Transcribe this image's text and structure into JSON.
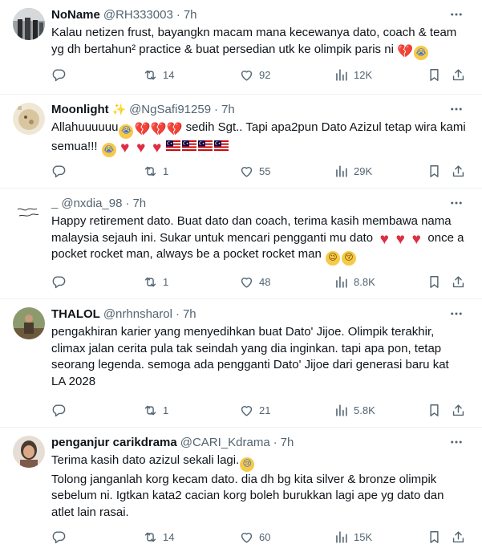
{
  "colors": {
    "text": "#0f1419",
    "muted": "#536471",
    "divider": "#eff3f4",
    "heart": "#dd2e44"
  },
  "tweets": [
    {
      "name": "NoName",
      "handle": "@RH333003",
      "time": "7h",
      "text1": "Kalau netizen frust, bayangkn macam mana kecewanya dato, coach & team yg dh bertahun² practice & buat persedian utk ke olimpik paris ni",
      "replies": "",
      "retweets": "14",
      "likes": "92",
      "views": "12K"
    },
    {
      "name": "Moonlight",
      "handle": "@NgSafi91259",
      "time": "7h",
      "text1": "Allahuuuuuu",
      "text2": "sedih Sgt.. Tapi apa2pun Dato Azizul tetap wira kami semua!!!",
      "replies": "",
      "retweets": "1",
      "likes": "55",
      "views": "29K"
    },
    {
      "name": "_",
      "handle": "@nxdia_98",
      "time": "7h",
      "text1": "Happy retirement dato. Buat dato dan coach, terima kasih membawa nama malaysia sejauh ini. Sukar untuk mencari pengganti mu dato",
      "text2": "once a pocket rocket man, always be a pocket rocket man",
      "replies": "",
      "retweets": "1",
      "likes": "48",
      "views": "8.8K"
    },
    {
      "name": "THALOL",
      "handle": "@nrhnsharol",
      "time": "7h",
      "text1": "pengakhiran karier yang menyedihkan buat Dato' Jijoe. Olimpik terakhir, climax jalan cerita pula tak seindah yang dia inginkan. tapi apa pon, tetap seorang legenda. semoga ada pengganti Dato' Jijoe dari generasi baru kat LA 2028",
      "replies": "",
      "retweets": "1",
      "likes": "21",
      "views": "5.8K"
    },
    {
      "name": "penganjur carikdrama",
      "handle": "@CARI_Kdrama",
      "time": "7h",
      "text1": "Terima kasih dato azizul sekali lagi.",
      "text2": "Tolong janganlah korg kecam dato. dia dh bg kita silver & bronze olimpik sebelum ni. Igtkan kata2 cacian korg boleh burukkan lagi ape yg dato dan atlet lain rasai.",
      "replies": "",
      "retweets": "14",
      "likes": "60",
      "views": "15K"
    }
  ],
  "icons": [
    "more-icon",
    "reply-icon",
    "retweet-icon",
    "like-icon",
    "views-icon",
    "bookmark-icon",
    "share-icon"
  ],
  "emojis": {
    "sob": "sob-emoji",
    "broken_heart": "broken-heart-emoji",
    "heart": "red-heart-emoji",
    "flag": "malaysia-flag-emoji",
    "wink": "wink-emoji",
    "kiss": "kiss-emoji",
    "tears": "crying-emoji"
  }
}
